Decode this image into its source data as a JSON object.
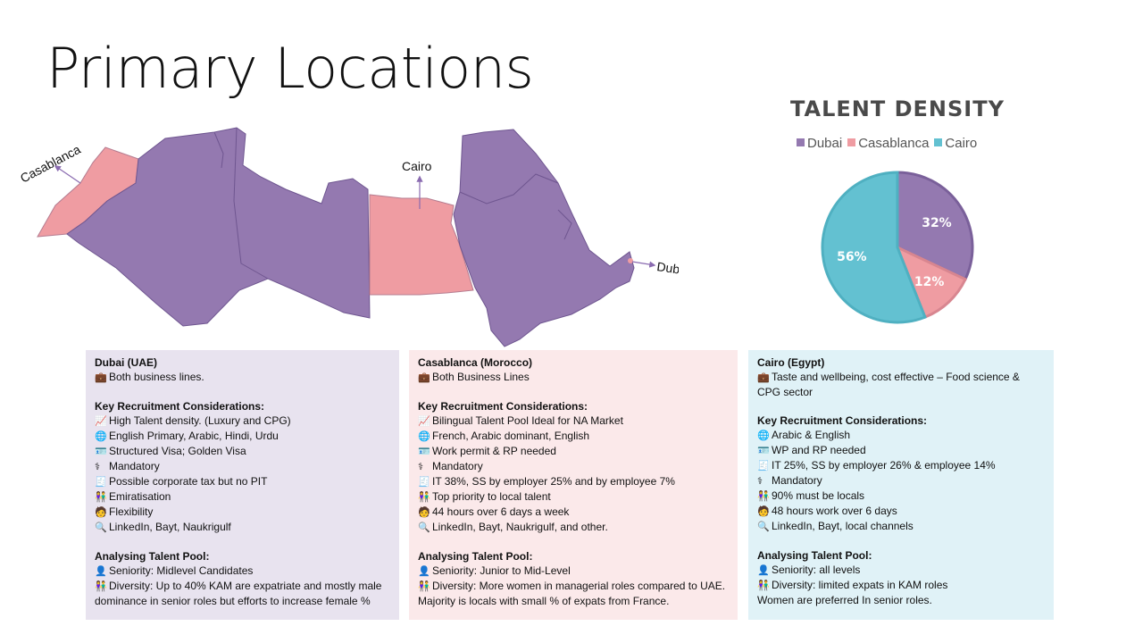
{
  "title": "Primary Locations",
  "map": {
    "labels": {
      "casablanca": "Casablanca",
      "cairo": "Cairo",
      "dubai": "Dubai"
    },
    "colors": {
      "purple": "#9479b0",
      "pink": "#ef9ca2",
      "arrow": "#8a6bb0"
    }
  },
  "chart_data": {
    "type": "pie",
    "title": "TALENT DENSITY",
    "legend_placement": "top",
    "categories": [
      "Dubai",
      "Casablanca",
      "Cairo"
    ],
    "values": [
      32,
      12,
      56
    ],
    "value_labels": [
      "32%",
      "12%",
      "56%"
    ],
    "colors": [
      "#9479b0",
      "#ef9ca2",
      "#63c1d1"
    ],
    "border_colors": [
      "#7a609a",
      "#d88690",
      "#4fb0c1"
    ]
  },
  "cards": {
    "dubai": {
      "heading": "Dubai (UAE)",
      "business": {
        "icon": "briefcase-icon",
        "text": "Both business lines."
      },
      "considerations_title": "Key Recruitment Considerations:",
      "considerations": [
        {
          "icon": "chart-up-icon",
          "text": "High Talent density. (Luxury and CPG)"
        },
        {
          "icon": "globe-icon",
          "text": "English Primary, Arabic, Hindi, Urdu"
        },
        {
          "icon": "id-card-icon",
          "text": "Structured Visa; Golden Visa"
        },
        {
          "icon": "stethoscope-icon",
          "text": "Mandatory"
        },
        {
          "icon": "receipt-icon",
          "text": "Possible corporate tax but no PIT"
        },
        {
          "icon": "people-icon",
          "text": "Emiratisation"
        },
        {
          "icon": "worker-icon",
          "text": "Flexibility"
        },
        {
          "icon": "search-icon",
          "text": "LinkedIn, Bayt, Naukrigulf"
        }
      ],
      "pool_title": "Analysing Talent Pool:",
      "pool": [
        {
          "icon": "person-icon",
          "text": "Seniority: Midlevel Candidates"
        },
        {
          "icon": "people-icon",
          "text": "Diversity: Up to 40% KAM are expatriate and mostly male dominance in senior roles but efforts to increase female %"
        }
      ]
    },
    "casablanca": {
      "heading": "Casablanca (Morocco)",
      "business": {
        "icon": "briefcase-icon",
        "text": "Both Business Lines"
      },
      "considerations_title": "Key Recruitment Considerations:",
      "considerations": [
        {
          "icon": "chart-up-icon",
          "text": "Bilingual Talent Pool Ideal for NA Market"
        },
        {
          "icon": "globe-icon",
          "text": "French, Arabic dominant, English"
        },
        {
          "icon": "id-card-icon",
          "text": "Work permit & RP needed"
        },
        {
          "icon": "stethoscope-icon",
          "text": "Mandatory"
        },
        {
          "icon": "receipt-icon",
          "text": "IT 38%, SS by employer 25% and by employee 7%"
        },
        {
          "icon": "people-icon",
          "text": "Top priority to local talent"
        },
        {
          "icon": "worker-icon",
          "text": "44 hours over 6 days a week"
        },
        {
          "icon": "search-icon",
          "text": "LinkedIn, Bayt, Naukrigulf, and other."
        }
      ],
      "pool_title": "Analysing Talent Pool:",
      "pool": [
        {
          "icon": "person-icon",
          "text": "Seniority: Junior to Mid-Level"
        },
        {
          "icon": "people-icon",
          "text": "Diversity:  More women in managerial roles compared to UAE."
        }
      ],
      "pool_extra": "Majority is locals with small % of expats from France."
    },
    "cairo": {
      "heading": "Cairo (Egypt)",
      "business": {
        "icon": "briefcase-icon",
        "text": "Taste and wellbeing, cost effective – Food science & CPG sector"
      },
      "considerations_title": "Key Recruitment Considerations:",
      "considerations": [
        {
          "icon": "globe-icon",
          "text": "Arabic & English"
        },
        {
          "icon": "id-card-icon",
          "text": "WP and RP needed"
        },
        {
          "icon": "receipt-icon",
          "text": "IT 25%, SS by employer 26% & employee 14%"
        },
        {
          "icon": "stethoscope-icon",
          "text": "Mandatory"
        },
        {
          "icon": "people-icon",
          "text": "90% must be locals"
        },
        {
          "icon": "worker-icon",
          "text": "48 hours work over 6 days"
        },
        {
          "icon": "search-icon",
          "text": "LinkedIn, Bayt, local channels"
        }
      ],
      "pool_title": "Analysing Talent Pool:",
      "pool": [
        {
          "icon": "person-icon",
          "text": "Seniority: all levels"
        },
        {
          "icon": "people-icon",
          "text": "Diversity: limited expats in KAM roles"
        }
      ],
      "pool_extra": "Women are preferred In senior roles."
    }
  }
}
